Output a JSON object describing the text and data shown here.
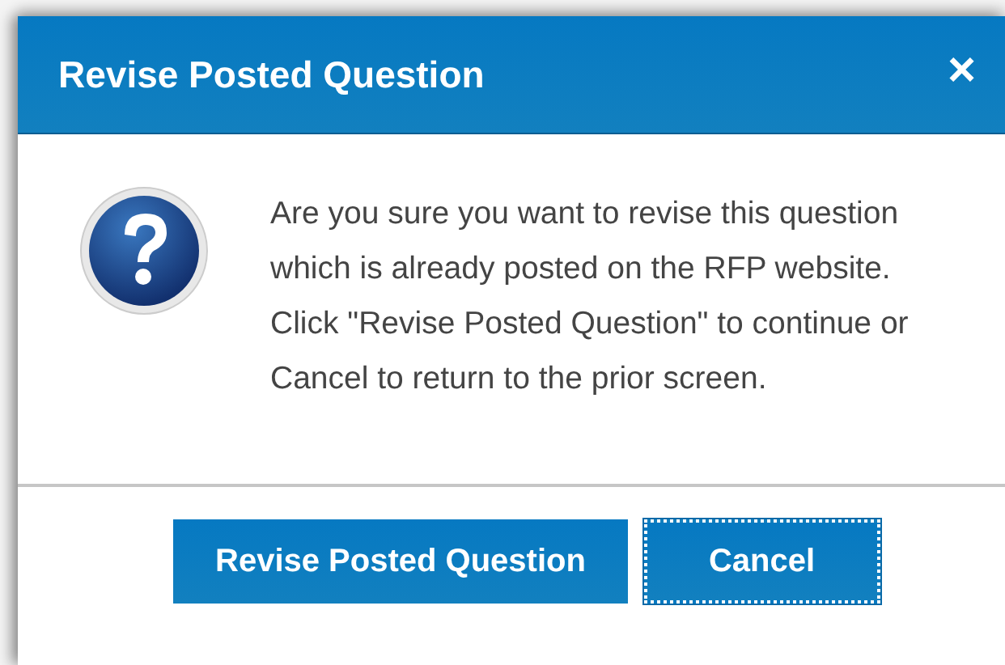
{
  "dialog": {
    "title": "Revise Posted Question",
    "close": "×",
    "message": "Are you sure you want to revise this question which is already posted on the RFP website. Click \"Revise Posted Question\" to continue or Cancel to return to the prior screen.",
    "buttons": [
      {
        "label": "Revise Posted Question",
        "focused": false
      },
      {
        "label": "Cancel",
        "focused": true
      }
    ]
  }
}
